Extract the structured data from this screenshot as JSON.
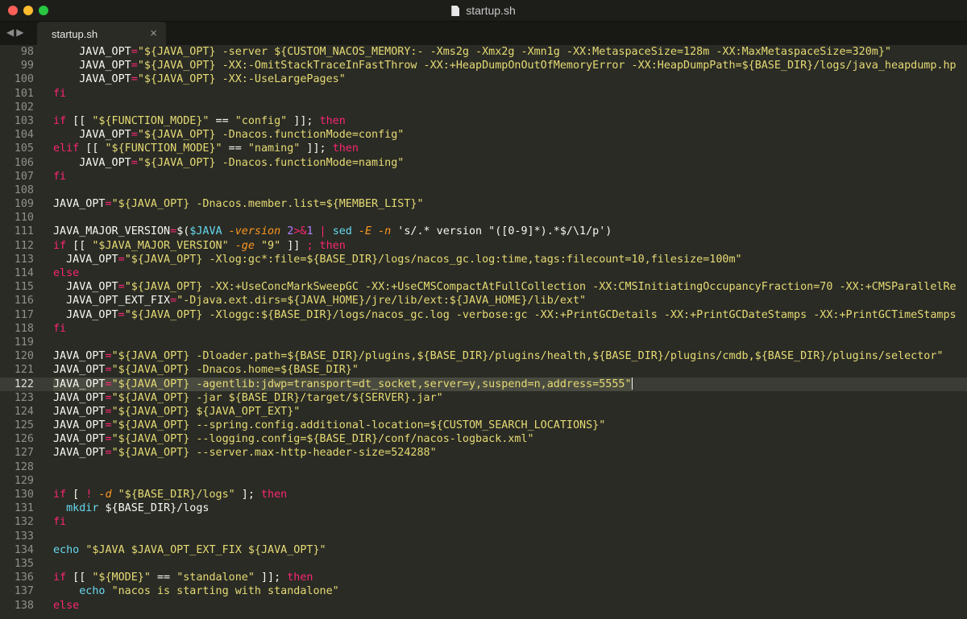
{
  "window": {
    "title": "startup.sh",
    "nav_back": "◀",
    "nav_forward": "▶"
  },
  "tab": {
    "label": "startup.sh",
    "close": "×"
  },
  "editor": {
    "highlighted_line": 122,
    "lines": [
      {
        "n": "98",
        "tokens": [
          {
            "t": "    JAVA_OPT",
            "c": "var"
          },
          {
            "t": "=",
            "c": "kw"
          },
          {
            "t": "\"${JAVA_OPT} -server ${CUSTOM_NACOS_MEMORY:- -Xms2g -Xmx2g -Xmn1g -XX:MetaspaceSize=128m -XX:MaxMetaspaceSize=320m}\"",
            "c": "str"
          }
        ]
      },
      {
        "n": "99",
        "tokens": [
          {
            "t": "    JAVA_OPT",
            "c": "var"
          },
          {
            "t": "=",
            "c": "kw"
          },
          {
            "t": "\"${JAVA_OPT} -XX:-OmitStackTraceInFastThrow -XX:+HeapDumpOnOutOfMemoryError -XX:HeapDumpPath=${BASE_DIR}/logs/java_heapdump.hp",
            "c": "str"
          }
        ]
      },
      {
        "n": "100",
        "tokens": [
          {
            "t": "    JAVA_OPT",
            "c": "var"
          },
          {
            "t": "=",
            "c": "kw"
          },
          {
            "t": "\"${JAVA_OPT} -XX:-UseLargePages\"",
            "c": "str"
          }
        ]
      },
      {
        "n": "101",
        "tokens": [
          {
            "t": "fi",
            "c": "kw"
          }
        ]
      },
      {
        "n": "102",
        "tokens": []
      },
      {
        "n": "103",
        "tokens": [
          {
            "t": "if",
            "c": "kw"
          },
          {
            "t": " [[ ",
            "c": "var"
          },
          {
            "t": "\"${FUNCTION_MODE}\"",
            "c": "str"
          },
          {
            "t": " == ",
            "c": "var"
          },
          {
            "t": "\"config\"",
            "c": "str"
          },
          {
            "t": " ]]; ",
            "c": "var"
          },
          {
            "t": "then",
            "c": "kw"
          }
        ]
      },
      {
        "n": "104",
        "tokens": [
          {
            "t": "    JAVA_OPT",
            "c": "var"
          },
          {
            "t": "=",
            "c": "kw"
          },
          {
            "t": "\"${JAVA_OPT} -Dnacos.functionMode=config\"",
            "c": "str"
          }
        ]
      },
      {
        "n": "105",
        "tokens": [
          {
            "t": "elif",
            "c": "kw"
          },
          {
            "t": " [[ ",
            "c": "var"
          },
          {
            "t": "\"${FUNCTION_MODE}\"",
            "c": "str"
          },
          {
            "t": " == ",
            "c": "var"
          },
          {
            "t": "\"naming\"",
            "c": "str"
          },
          {
            "t": " ]]; ",
            "c": "var"
          },
          {
            "t": "then",
            "c": "kw"
          }
        ]
      },
      {
        "n": "106",
        "tokens": [
          {
            "t": "    JAVA_OPT",
            "c": "var"
          },
          {
            "t": "=",
            "c": "kw"
          },
          {
            "t": "\"${JAVA_OPT} -Dnacos.functionMode=naming\"",
            "c": "str"
          }
        ]
      },
      {
        "n": "107",
        "tokens": [
          {
            "t": "fi",
            "c": "kw"
          }
        ]
      },
      {
        "n": "108",
        "tokens": []
      },
      {
        "n": "109",
        "tokens": [
          {
            "t": "JAVA_OPT",
            "c": "var"
          },
          {
            "t": "=",
            "c": "kw"
          },
          {
            "t": "\"${JAVA_OPT} -Dnacos.member.list=${MEMBER_LIST}\"",
            "c": "str"
          }
        ]
      },
      {
        "n": "110",
        "tokens": []
      },
      {
        "n": "111",
        "tokens": [
          {
            "t": "JAVA_MAJOR_VERSION",
            "c": "var"
          },
          {
            "t": "=",
            "c": "kw"
          },
          {
            "t": "$(",
            "c": "var"
          },
          {
            "t": "$JAVA",
            "c": "fn"
          },
          {
            "t": " -version",
            "c": "it"
          },
          {
            "t": " 2",
            "c": "num"
          },
          {
            "t": ">&",
            "c": "kw"
          },
          {
            "t": "1",
            "c": "num"
          },
          {
            "t": " | ",
            "c": "kw"
          },
          {
            "t": "sed",
            "c": "fn"
          },
          {
            "t": " -E -n",
            "c": "it"
          },
          {
            "t": " 's/.* version \"([0-9]*).*$/\\1/p')",
            "c": "var"
          }
        ]
      },
      {
        "n": "112",
        "tokens": [
          {
            "t": "if",
            "c": "kw"
          },
          {
            "t": " [[ ",
            "c": "var"
          },
          {
            "t": "\"$JAVA_MAJOR_VERSION\"",
            "c": "str"
          },
          {
            "t": " -ge",
            "c": "it"
          },
          {
            "t": " ",
            "c": "var"
          },
          {
            "t": "\"9\"",
            "c": "str"
          },
          {
            "t": " ]] ",
            "c": "var"
          },
          {
            "t": "; then",
            "c": "kw"
          }
        ]
      },
      {
        "n": "113",
        "tokens": [
          {
            "t": "  JAVA_OPT",
            "c": "var"
          },
          {
            "t": "=",
            "c": "kw"
          },
          {
            "t": "\"${JAVA_OPT} -Xlog:gc*:file=${BASE_DIR}/logs/nacos_gc.log:time,tags:filecount=10,filesize=100m\"",
            "c": "str"
          }
        ]
      },
      {
        "n": "114",
        "tokens": [
          {
            "t": "else",
            "c": "kw"
          }
        ]
      },
      {
        "n": "115",
        "tokens": [
          {
            "t": "  JAVA_OPT",
            "c": "var"
          },
          {
            "t": "=",
            "c": "kw"
          },
          {
            "t": "\"${JAVA_OPT} -XX:+UseConcMarkSweepGC -XX:+UseCMSCompactAtFullCollection -XX:CMSInitiatingOccupancyFraction=70 -XX:+CMSParallelRe",
            "c": "str"
          }
        ]
      },
      {
        "n": "116",
        "tokens": [
          {
            "t": "  JAVA_OPT_EXT_FIX",
            "c": "var"
          },
          {
            "t": "=",
            "c": "kw"
          },
          {
            "t": "\"-Djava.ext.dirs=${JAVA_HOME}/jre/lib/ext:${JAVA_HOME}/lib/ext\"",
            "c": "str"
          }
        ]
      },
      {
        "n": "117",
        "tokens": [
          {
            "t": "  JAVA_OPT",
            "c": "var"
          },
          {
            "t": "=",
            "c": "kw"
          },
          {
            "t": "\"${JAVA_OPT} -Xloggc:${BASE_DIR}/logs/nacos_gc.log -verbose:gc -XX:+PrintGCDetails -XX:+PrintGCDateStamps -XX:+PrintGCTimeStamps",
            "c": "str"
          }
        ]
      },
      {
        "n": "118",
        "tokens": [
          {
            "t": "fi",
            "c": "kw"
          }
        ]
      },
      {
        "n": "119",
        "tokens": []
      },
      {
        "n": "120",
        "tokens": [
          {
            "t": "JAVA_OPT",
            "c": "var"
          },
          {
            "t": "=",
            "c": "kw"
          },
          {
            "t": "\"${JAVA_OPT} -Dloader.path=${BASE_DIR}/plugins,${BASE_DIR}/plugins/health,${BASE_DIR}/plugins/cmdb,${BASE_DIR}/plugins/selector\"",
            "c": "str"
          }
        ]
      },
      {
        "n": "121",
        "tokens": [
          {
            "t": "JAVA_OPT",
            "c": "var"
          },
          {
            "t": "=",
            "c": "kw"
          },
          {
            "t": "\"${JAVA_OPT} -Dnacos.home=${BASE_DIR}\"",
            "c": "str"
          }
        ]
      },
      {
        "n": "122",
        "tokens": [
          {
            "t": "JAVA_OPT",
            "c": "var"
          },
          {
            "t": "=",
            "c": "kw"
          },
          {
            "t": "\"${JAVA_OPT} -agentlib:jdwp=transport=dt_socket,server=y,suspend=n,address=5555\"",
            "c": "str"
          }
        ]
      },
      {
        "n": "123",
        "tokens": [
          {
            "t": "JAVA_OPT",
            "c": "var"
          },
          {
            "t": "=",
            "c": "kw"
          },
          {
            "t": "\"${JAVA_OPT} -jar ${BASE_DIR}/target/${SERVER}.jar\"",
            "c": "str"
          }
        ]
      },
      {
        "n": "124",
        "tokens": [
          {
            "t": "JAVA_OPT",
            "c": "var"
          },
          {
            "t": "=",
            "c": "kw"
          },
          {
            "t": "\"${JAVA_OPT} ${JAVA_OPT_EXT}\"",
            "c": "str"
          }
        ]
      },
      {
        "n": "125",
        "tokens": [
          {
            "t": "JAVA_OPT",
            "c": "var"
          },
          {
            "t": "=",
            "c": "kw"
          },
          {
            "t": "\"${JAVA_OPT} --spring.config.additional-location=${CUSTOM_SEARCH_LOCATIONS}\"",
            "c": "str"
          }
        ]
      },
      {
        "n": "126",
        "tokens": [
          {
            "t": "JAVA_OPT",
            "c": "var"
          },
          {
            "t": "=",
            "c": "kw"
          },
          {
            "t": "\"${JAVA_OPT} --logging.config=${BASE_DIR}/conf/nacos-logback.xml\"",
            "c": "str"
          }
        ]
      },
      {
        "n": "127",
        "tokens": [
          {
            "t": "JAVA_OPT",
            "c": "var"
          },
          {
            "t": "=",
            "c": "kw"
          },
          {
            "t": "\"${JAVA_OPT} --server.max-http-header-size=524288\"",
            "c": "str"
          }
        ]
      },
      {
        "n": "128",
        "tokens": []
      },
      {
        "n": "129",
        "tokens": []
      },
      {
        "n": "130",
        "tokens": [
          {
            "t": "if",
            "c": "kw"
          },
          {
            "t": " [ ",
            "c": "var"
          },
          {
            "t": "!",
            "c": "kw"
          },
          {
            "t": " -d",
            "c": "it"
          },
          {
            "t": " ",
            "c": "var"
          },
          {
            "t": "\"${BASE_DIR}/logs\"",
            "c": "str"
          },
          {
            "t": " ]; ",
            "c": "var"
          },
          {
            "t": "then",
            "c": "kw"
          }
        ]
      },
      {
        "n": "131",
        "tokens": [
          {
            "t": "  ",
            "c": "var"
          },
          {
            "t": "mkdir",
            "c": "fn"
          },
          {
            "t": " ${BASE_DIR}/logs",
            "c": "var"
          }
        ]
      },
      {
        "n": "132",
        "tokens": [
          {
            "t": "fi",
            "c": "kw"
          }
        ]
      },
      {
        "n": "133",
        "tokens": []
      },
      {
        "n": "134",
        "tokens": [
          {
            "t": "echo",
            "c": "fn"
          },
          {
            "t": " ",
            "c": "var"
          },
          {
            "t": "\"$JAVA $JAVA_OPT_EXT_FIX ${JAVA_OPT}\"",
            "c": "str"
          }
        ]
      },
      {
        "n": "135",
        "tokens": []
      },
      {
        "n": "136",
        "tokens": [
          {
            "t": "if",
            "c": "kw"
          },
          {
            "t": " [[ ",
            "c": "var"
          },
          {
            "t": "\"${MODE}\"",
            "c": "str"
          },
          {
            "t": " == ",
            "c": "var"
          },
          {
            "t": "\"standalone\"",
            "c": "str"
          },
          {
            "t": " ]]; ",
            "c": "var"
          },
          {
            "t": "then",
            "c": "kw"
          }
        ]
      },
      {
        "n": "137",
        "tokens": [
          {
            "t": "    ",
            "c": "var"
          },
          {
            "t": "echo",
            "c": "fn"
          },
          {
            "t": " ",
            "c": "var"
          },
          {
            "t": "\"nacos is starting with standalone\"",
            "c": "str"
          }
        ]
      },
      {
        "n": "138",
        "tokens": [
          {
            "t": "else",
            "c": "kw"
          }
        ]
      }
    ]
  }
}
